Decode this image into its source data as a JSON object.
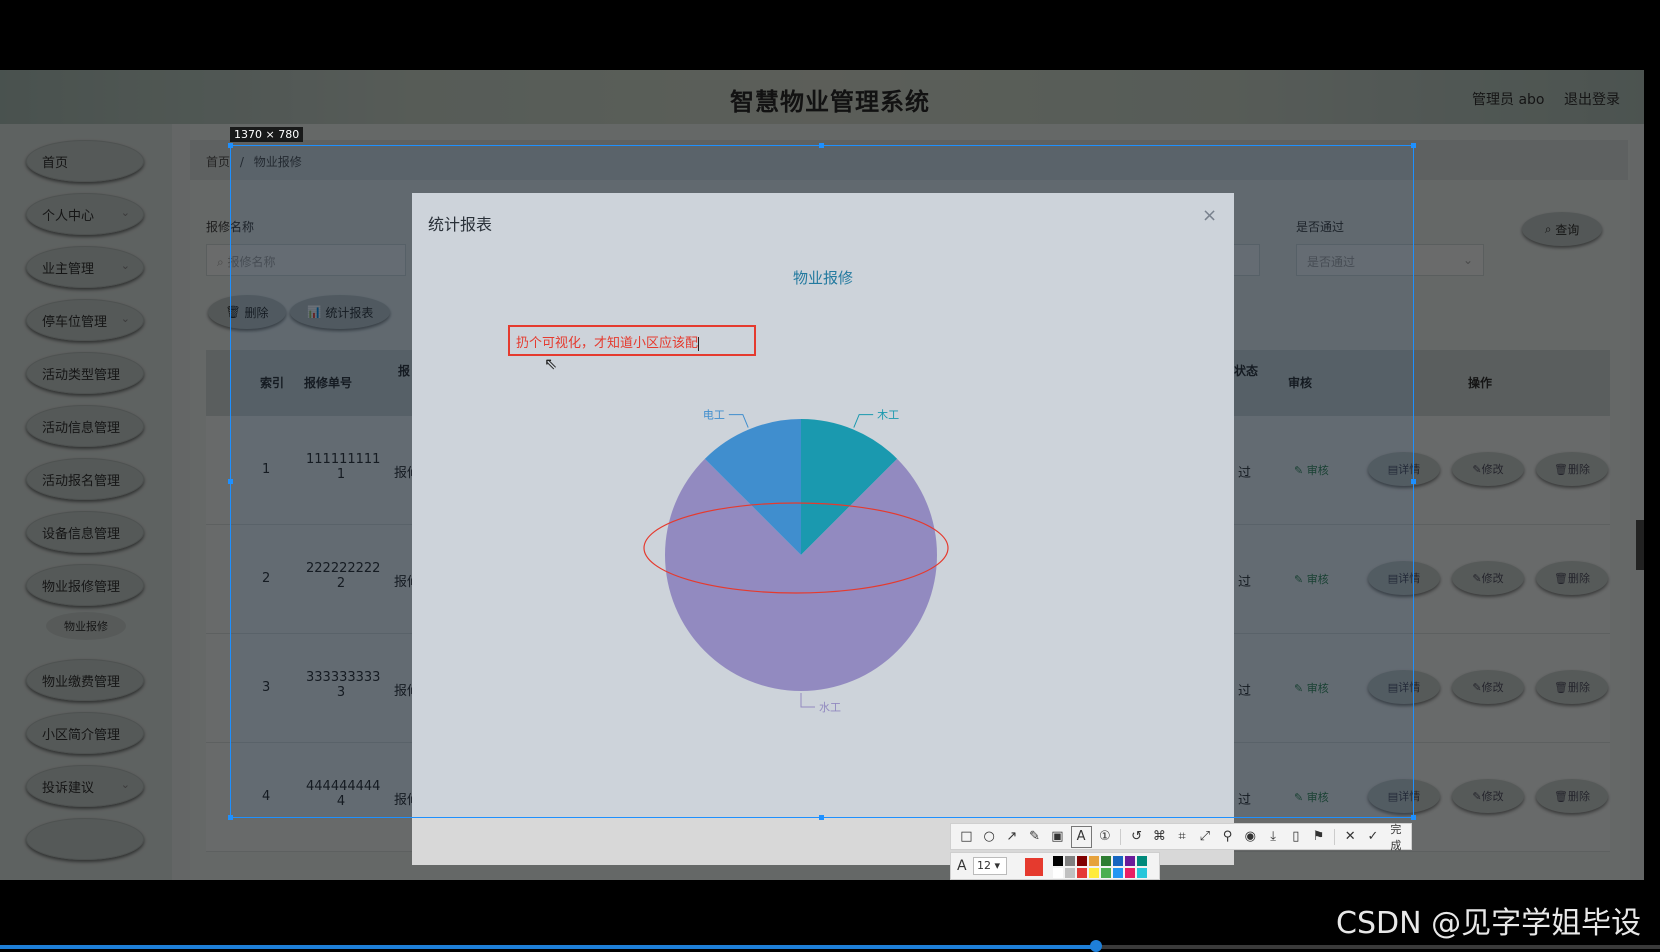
{
  "app": {
    "title": "智慧物业管理系统",
    "user": "管理员 abo",
    "logout": "退出登录"
  },
  "sidebar": {
    "items": [
      {
        "label": "首页",
        "has_children": false
      },
      {
        "label": "个人中心",
        "has_children": true
      },
      {
        "label": "业主管理",
        "has_children": true
      },
      {
        "label": "停车位管理",
        "has_children": true
      },
      {
        "label": "活动类型管理",
        "has_children": false
      },
      {
        "label": "活动信息管理",
        "has_children": false
      },
      {
        "label": "活动报名管理",
        "has_children": false
      },
      {
        "label": "设备信息管理",
        "has_children": false
      },
      {
        "label": "物业报修管理",
        "has_children": false
      },
      {
        "label": "物业缴费管理",
        "has_children": false
      },
      {
        "label": "小区简介管理",
        "has_children": false
      },
      {
        "label": "投诉建议",
        "has_children": true
      }
    ],
    "sub_item": "物业报修"
  },
  "breadcrumb": {
    "home": "首页",
    "sep": "/",
    "current": "物业报修"
  },
  "search": {
    "name_label": "报修名称",
    "name_placeholder": "报修名称",
    "pass_label": "是否通过",
    "pass_placeholder": "是否通过",
    "query_button": "查询"
  },
  "actions": {
    "delete": "删除",
    "report": "统计报表"
  },
  "table": {
    "headers": {
      "index": "索引",
      "order_no": "报修单号",
      "name": "报",
      "status": "状态",
      "audit": "审核",
      "ops": "操作"
    },
    "rows": [
      {
        "index": "1",
        "order_no_line1": "111111111",
        "order_no_line2": "1",
        "name": "报修",
        "status": "过"
      },
      {
        "index": "2",
        "order_no_line1": "222222222",
        "order_no_line2": "2",
        "name": "报修",
        "status": "过"
      },
      {
        "index": "3",
        "order_no_line1": "333333333",
        "order_no_line2": "3",
        "name": "报修",
        "status": "过"
      },
      {
        "index": "4",
        "order_no_line1": "444444444",
        "order_no_line2": "4",
        "name": "报修",
        "status": "过"
      }
    ],
    "audit_label": "审核",
    "op_detail": "详情",
    "op_edit": "修改",
    "op_delete": "删除"
  },
  "modal": {
    "title": "统计报表",
    "close": "×"
  },
  "chart_data": {
    "type": "pie",
    "title": "物业报修",
    "series": [
      {
        "label": "木工",
        "value": 1,
        "color": "#1eb1c2"
      },
      {
        "label": "水工",
        "value": 6,
        "color": "#b09fd8"
      },
      {
        "label": "电工",
        "value": 1,
        "color": "#4ca3e8"
      }
    ],
    "start_angle_deg": -90,
    "legend": "none"
  },
  "capture": {
    "size_label": "1370 × 780",
    "annotation_text": "扔个可视化，才知道小区应该配",
    "font_size_value": "12",
    "done_label": "完成",
    "accent_color": "#e53a2e",
    "colors": [
      "#000000",
      "#808080",
      "#800000",
      "#e6a23c",
      "#2e7d32",
      "#1565c0",
      "#6a1b9a",
      "#00897b",
      "#ffffff",
      "#c0c0c0",
      "#e53935",
      "#ffeb3b",
      "#4caf50",
      "#2196f3",
      "#e91e63",
      "#26c6da"
    ]
  },
  "watermark": "CSDN @见字学姐毕设",
  "video": {
    "progress": 0.66
  }
}
